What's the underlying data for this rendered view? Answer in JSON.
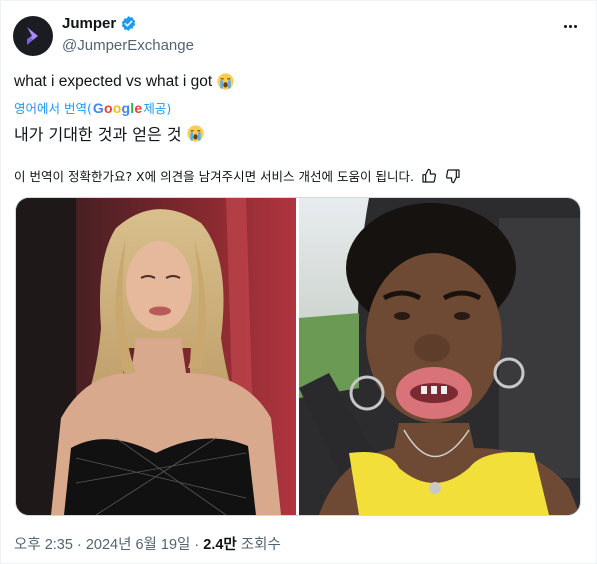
{
  "author": {
    "name": "Jumper",
    "handle": "@JumperExchange",
    "verified": true,
    "avatar_icon": "jumper-logo-icon",
    "avatar_bg": "#1b1b22",
    "avatar_accent": "#a98bf5"
  },
  "tweet": {
    "text": "what i expected vs what i got",
    "text_emoji": "loudly-crying-face-icon",
    "translation_prefix": "영어에서 번역(",
    "translation_brand": "Google",
    "translation_suffix": " 제공)",
    "translated_text": "내가 기대한 것과 얻은 것",
    "translated_emoji": "loudly-crying-face-icon",
    "feedback_question": "이 번역이 정확한가요? X에 의견을 남겨주시면 서비스 개선에 도움이 됩니다.",
    "thumbs_up_icon": "thumbs-up-icon",
    "thumbs_down_icon": "thumbs-down-icon"
  },
  "media": {
    "left_image": "woman-blonde-red-carpet-photo",
    "right_image": "woman-in-car-photo"
  },
  "meta": {
    "time": "오후 2:35",
    "sep1": " · ",
    "date": "2024년 6월 19일",
    "sep2": " · ",
    "views_count": "2.4만",
    "views_label": " 조회수"
  },
  "colors": {
    "link_blue": "#1d9bf0",
    "verified_blue": "#1d9bf0",
    "text_primary": "#0f1419",
    "text_secondary": "#536471",
    "border": "#cfd9de"
  }
}
